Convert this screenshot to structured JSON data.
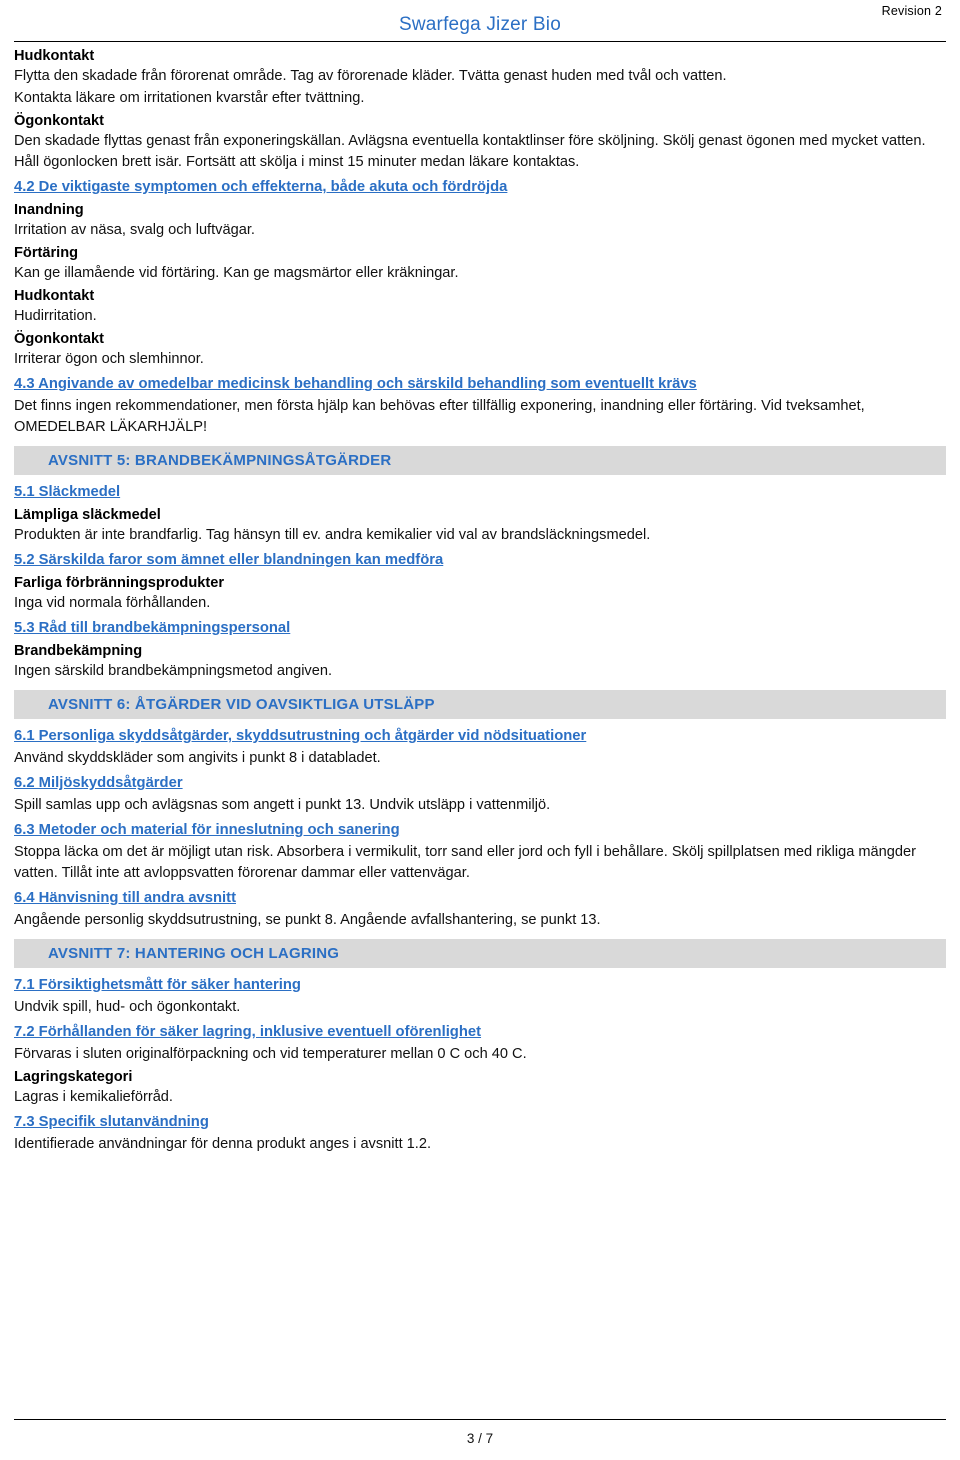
{
  "header": {
    "revision": "Revision 2",
    "title": "Swarfega Jizer Bio"
  },
  "blocks": [
    {
      "type": "subhead",
      "text": "Hudkontakt"
    },
    {
      "type": "text",
      "text": "Flytta den skadade från förorenat område.   Tag av förorenade kläder.   Tvätta genast huden med tvål och vatten."
    },
    {
      "type": "text",
      "text": "Kontakta läkare om irritationen kvarstår efter tvättning."
    },
    {
      "type": "subhead",
      "text": "Ögonkontakt"
    },
    {
      "type": "text",
      "text": "Den skadade flyttas genast från exponeringskällan.   Avlägsna eventuella kontaktlinser före sköljning.   Skölj genast ögonen med mycket vatten.  Håll ögonlocken brett isär.   Fortsätt att skölja i minst 15 minuter medan läkare kontaktas."
    },
    {
      "type": "linkhead",
      "text": "4.2 De viktigaste symptomen och effekterna, både akuta och fördröjda"
    },
    {
      "type": "subhead",
      "text": "Inandning"
    },
    {
      "type": "text",
      "text": "Irritation av näsa,  svalg och luftvägar."
    },
    {
      "type": "subhead",
      "text": "Förtäring"
    },
    {
      "type": "text",
      "text": "Kan ge illamående vid förtäring.   Kan ge magsmärtor eller kräkningar."
    },
    {
      "type": "subhead",
      "text": "Hudkontakt"
    },
    {
      "type": "text",
      "text": "Hudirritation."
    },
    {
      "type": "subhead",
      "text": "Ögonkontakt"
    },
    {
      "type": "text",
      "text": "Irriterar ögon och slemhinnor."
    },
    {
      "type": "linkhead",
      "text": "4.3 Angivande av omedelbar medicinsk behandling och särskild behandling som eventuellt krävs"
    },
    {
      "type": "text",
      "text": "Det finns ingen rekommendationer,  men första hjälp kan behövas efter tillfällig exponering,  inandning eller förtäring. Vid tveksamhet,  OMEDELBAR LÄKARHJÄLP!"
    },
    {
      "type": "band",
      "text": "AVSNITT 5: BRANDBEKÄMPNINGSÅTGÄRDER"
    },
    {
      "type": "linkhead",
      "text": "5.1 Släckmedel"
    },
    {
      "type": "subhead",
      "text": "Lämpliga släckmedel"
    },
    {
      "type": "text",
      "text": "Produkten är inte brandfarlig. Tag hänsyn till ev. andra kemikalier vid val av brandsläckningsmedel."
    },
    {
      "type": "linkhead",
      "text": "5.2 Särskilda faror som ämnet eller blandningen kan medföra"
    },
    {
      "type": "subhead",
      "text": "Farliga förbränningsprodukter"
    },
    {
      "type": "text",
      "text": "Inga vid normala förhållanden."
    },
    {
      "type": "linkhead",
      "text": "5.3 Råd till brandbekämpningspersonal"
    },
    {
      "type": "subhead",
      "text": "Brandbekämpning"
    },
    {
      "type": "text",
      "text": "Ingen särskild brandbekämpningsmetod angiven."
    },
    {
      "type": "band",
      "text": "AVSNITT 6: ÅTGÄRDER VID OAVSIKTLIGA UTSLÄPP"
    },
    {
      "type": "linkhead",
      "text": "6.1 Personliga skyddsåtgärder, skyddsutrustning och åtgärder vid nödsituationer"
    },
    {
      "type": "text",
      "text": "Använd skyddskläder som angivits i punkt 8 i databladet."
    },
    {
      "type": "linkhead",
      "text": "6.2 Miljöskyddsåtgärder"
    },
    {
      "type": "text",
      "text": "Spill samlas upp och avlägsnas som angett i punkt 13. Undvik utsläpp i vattenmiljö."
    },
    {
      "type": "linkhead",
      "text": "6.3 Metoder och material för inneslutning och sanering"
    },
    {
      "type": "text",
      "text": "Stoppa läcka om det är möjligt utan risk.   Absorbera i vermikulit,  torr sand eller jord och fyll i behållare.  Skölj spillplatsen med rikliga mängder vatten.  Tillåt inte att avloppsvatten förorenar dammar eller vattenvägar."
    },
    {
      "type": "linkhead",
      "text": "6.4 Hänvisning till andra avsnitt"
    },
    {
      "type": "text",
      "text": "Angående personlig skyddsutrustning,  se punkt 8. Angående avfallshantering,  se punkt 13."
    },
    {
      "type": "band",
      "text": "AVSNITT 7: HANTERING OCH LAGRING"
    },
    {
      "type": "linkhead",
      "text": "7.1 Försiktighetsmått för säker hantering"
    },
    {
      "type": "text",
      "text": "Undvik spill,  hud- och ögonkontakt."
    },
    {
      "type": "linkhead",
      "text": "7.2 Förhållanden för säker lagring, inklusive eventuell oförenlighet"
    },
    {
      "type": "text",
      "text": "Förvaras i sluten originalförpackning och vid temperaturer mellan 0 C och 40 C."
    },
    {
      "type": "subhead",
      "text": "Lagringskategori"
    },
    {
      "type": "text",
      "text": "Lagras i kemikalieförråd."
    },
    {
      "type": "linkhead",
      "text": "7.3 Specifik slutanvändning"
    },
    {
      "type": "text",
      "text": "Identifierade användningar för denna produkt anges i avsnitt 1.2."
    }
  ],
  "footer": {
    "page": "3 / 7"
  }
}
